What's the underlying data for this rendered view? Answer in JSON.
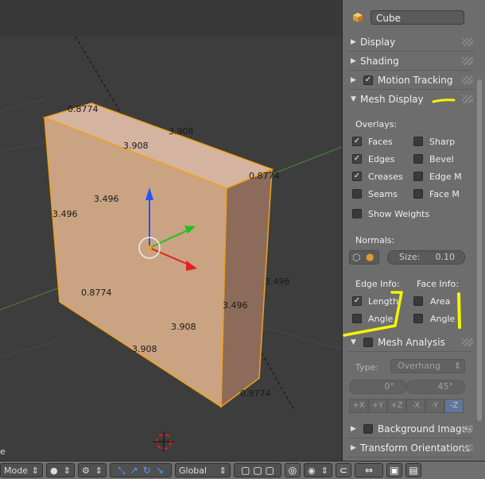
{
  "viewport": {
    "dimensions": {
      "top_left": "0.8774",
      "top_center": "3.908",
      "top_front": "3.908",
      "top_right": "0.8774",
      "front_left_height": "3.496",
      "front_inner_height": "3.496",
      "right_outer_height": "3.496",
      "right_inner_height": "3.496",
      "bottom_left": "0.8774",
      "bottom_inner": "3.908",
      "bottom_front": "3.908",
      "bottom_right": "0.8774"
    },
    "colors": {
      "face": "#c9a382",
      "face_right": "#8c6b5a",
      "face_top": "#d4b4a0",
      "edge": "#f0a020"
    }
  },
  "footer": {
    "mode_label": "Mode",
    "orientation_label": "Global",
    "corner_text": "e"
  },
  "panel": {
    "object_name": "Cube",
    "sections": {
      "display": "Display",
      "shading": "Shading",
      "motion_tracking": "Motion Tracking",
      "mesh_display": "Mesh Display",
      "mesh_analysis": "Mesh Analysis",
      "background_images": "Background Images",
      "transform_orientations": "Transform Orientations"
    },
    "overlays": {
      "heading": "Overlays:",
      "faces": "Faces",
      "edges": "Edges",
      "creases": "Creases",
      "seams": "Seams",
      "sharp": "Sharp",
      "bevel": "Bevel",
      "edge_marks": "Edge M",
      "face_marks": "Face M",
      "show_weights": "Show Weights"
    },
    "normals": {
      "heading": "Normals:",
      "size_label": "Size:",
      "size_value": "0.10"
    },
    "edge_info": {
      "heading": "Edge Info:",
      "length": "Length",
      "angle": "Angle"
    },
    "face_info": {
      "heading": "Face Info:",
      "area": "Area",
      "angle": "Angle"
    },
    "analysis": {
      "type_label": "Type:",
      "type_value": "Overhang",
      "min_value": "0°",
      "max_value": "45°",
      "axis_buttons": [
        "+X",
        "+Y",
        "+Z",
        "-X",
        "-Y",
        "-Z"
      ],
      "active_axis": "-Z"
    },
    "annotation_color": "#f5f500"
  }
}
